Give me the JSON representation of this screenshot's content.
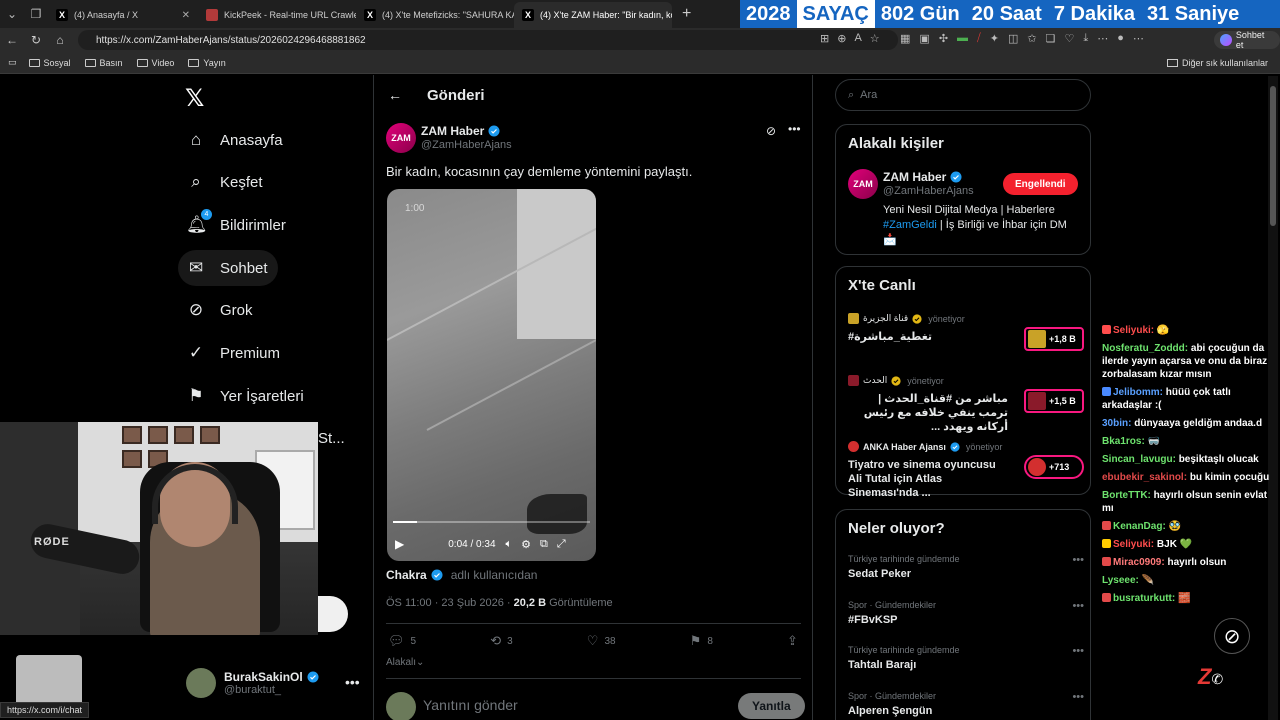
{
  "browser": {
    "tabs": [
      {
        "title": "(4) Anasayfa / X",
        "favicon": "x-icon",
        "active": false
      },
      {
        "title": "KickPeek - Real-time URL Crawler",
        "favicon": "kickpeek-icon",
        "active": false
      },
      {
        "title": "(4) X'te Metefizicks: \"SAHURA KA",
        "favicon": "x-icon",
        "active": false
      },
      {
        "title": "(4) X'te ZAM Haber: \"Bir kadın, koc",
        "favicon": "x-icon",
        "active": true
      }
    ],
    "url": "https://x.com/ZamHaberAjans/status/2026024296468881862",
    "chat_button": "Sohbet et",
    "bookmarks": [
      "Sosyal",
      "Basın",
      "Video",
      "Yayın"
    ],
    "bookmarks_other": "Diğer sık kullanılanlar",
    "status_url": "https://x.com/i/chat"
  },
  "counter": {
    "year": "2028",
    "label": "SAYAÇ",
    "days": "802 Gün",
    "hours": "20 Saat",
    "minutes": "7 Dakika",
    "seconds": "31 Saniye"
  },
  "sidebar": {
    "items": [
      {
        "label": "Anasayfa",
        "icon": "home-icon"
      },
      {
        "label": "Keşfet",
        "icon": "search-icon"
      },
      {
        "label": "Bildirimler",
        "icon": "bell-icon",
        "badge": "4"
      },
      {
        "label": "Sohbet",
        "icon": "mail-icon"
      },
      {
        "label": "Grok",
        "icon": "grok-icon"
      },
      {
        "label": "Premium",
        "icon": "verified-icon"
      },
      {
        "label": "Yer İşaretleri",
        "icon": "bookmark-icon"
      }
    ],
    "more_partial": "St...",
    "profile": {
      "name": "BurakSakinOl",
      "handle": "@buraktut_"
    }
  },
  "main": {
    "title": "Gönderi",
    "post": {
      "author": "ZAM Haber",
      "handle": "@ZamHaberAjans",
      "avatar_text": "ZAM",
      "text": "Bir kadın, kocasının çay demleme yöntemini paylaştı.",
      "video": {
        "overlay_time": "1:00",
        "current": "0:04",
        "duration": "0:34",
        "progress": 0.12
      },
      "source_name": "Chakra",
      "source_suffix": "adlı kullanıcıdan",
      "time": "ÖS 11:00 · 23 Şub 2026 · ",
      "views": "20,2 B",
      "views_label": " Görüntüleme",
      "replies": "5",
      "reposts": "3",
      "likes": "38",
      "bookmarks": "8"
    },
    "relevant": "Alakalı",
    "reply_placeholder": "Yanıtını gönder",
    "reply_button": "Yanıtla"
  },
  "right": {
    "search_placeholder": "Ara",
    "related": {
      "title": "Alakalı kişiler",
      "name": "ZAM Haber",
      "handle": "@ZamHaberAjans",
      "avatar_text": "ZAM",
      "button": "Engellendi",
      "bio_1": "Yeni Nesil Dijital Medya | Haberlere",
      "bio_tag": "#ZamGeldi",
      "bio_2": " | İş Birliği ve İhbar için DM",
      "bio_3": "📩"
    },
    "live": {
      "title": "X'te Canlı",
      "items": [
        {
          "host": "قناة الجزيرة",
          "role": "yönetiyor",
          "title": "#تغطية_مباشرة",
          "count": "+1,8 B",
          "color": "#c9a227"
        },
        {
          "host": "الحدث",
          "role": "yönetiyor",
          "title": "مباشر من #قناة_الحدث | ترمب ينفي خلافه مع رئيس أركانه ويهدد ...",
          "count": "+1,5 B",
          "color": "#8a1a2a"
        },
        {
          "host": "ANKA Haber Ajansı",
          "role": "yönetiyor",
          "title": "Tiyatro ve sinema oyuncusu Ali Tutal için Atlas Sineması'nda ...",
          "count": "+713",
          "color": "#d32f2f"
        }
      ]
    },
    "trends": {
      "title": "Neler oluyor?",
      "items": [
        {
          "category": "Türkiye tarihinde gündemde",
          "name": "Sedat Peker"
        },
        {
          "category": "Spor · Gündemdekiler",
          "name": "#FBvKSP"
        },
        {
          "category": "Türkiye tarihinde gündemde",
          "name": "Tahtalı Barajı"
        },
        {
          "category": "Spor · Gündemdekiler",
          "name": "Alperen Şengün"
        }
      ]
    }
  },
  "chat": [
    {
      "user": "Seliyuki:",
      "color": "#ff4d4d",
      "msg": "🫣",
      "pre": "#ff4d4d"
    },
    {
      "user": "Nosferatu_Zoddd:",
      "color": "#6ee36e",
      "msg": "abi çocuğun da ilerde yayın açarsa ve onu da biraz zorbalasam kızar mısın",
      "pre": ""
    },
    {
      "user": "Jelibomm:",
      "color": "#5aa0ff",
      "msg": "hüüü çok tatlı arkadaşlar :(",
      "pre": "#4a8aff"
    },
    {
      "user": "30bin:",
      "color": "#5aa0ff",
      "msg": "dünyaaya geldiğm andaa.d",
      "pre": ""
    },
    {
      "user": "Bka1ros:",
      "color": "#6ee36e",
      "msg": "🥽",
      "pre": ""
    },
    {
      "user": "Sincan_lavugu:",
      "color": "#6ee36e",
      "msg": "beşiktaşlı olucak",
      "pre": ""
    },
    {
      "user": "ebubekir_sakinol:",
      "color": "#e24a4a",
      "msg": "bu kimin çocuğu",
      "pre": ""
    },
    {
      "user": "BorteTTK:",
      "color": "#6ee36e",
      "msg": "hayırlı olsun senin evlat mı",
      "pre": ""
    },
    {
      "user": "KenanDag:",
      "color": "#6ee36e",
      "msg": "🥸",
      "pre": "#e24a4a"
    },
    {
      "user": "Seliyuki:",
      "color": "#ff4d4d",
      "msg": "BJK 💚",
      "pre": "#ffcc00"
    },
    {
      "user": "Mirac0909:",
      "color": "#ff7a7a",
      "msg": "hayırlı olsun",
      "pre": "#e24a4a"
    },
    {
      "user": "Lyseee:",
      "color": "#6ee36e",
      "msg": "🪶",
      "pre": ""
    },
    {
      "user": "busraturkutt:",
      "color": "#6ee36e",
      "msg": "🧱",
      "pre": "#e24a4a"
    }
  ]
}
